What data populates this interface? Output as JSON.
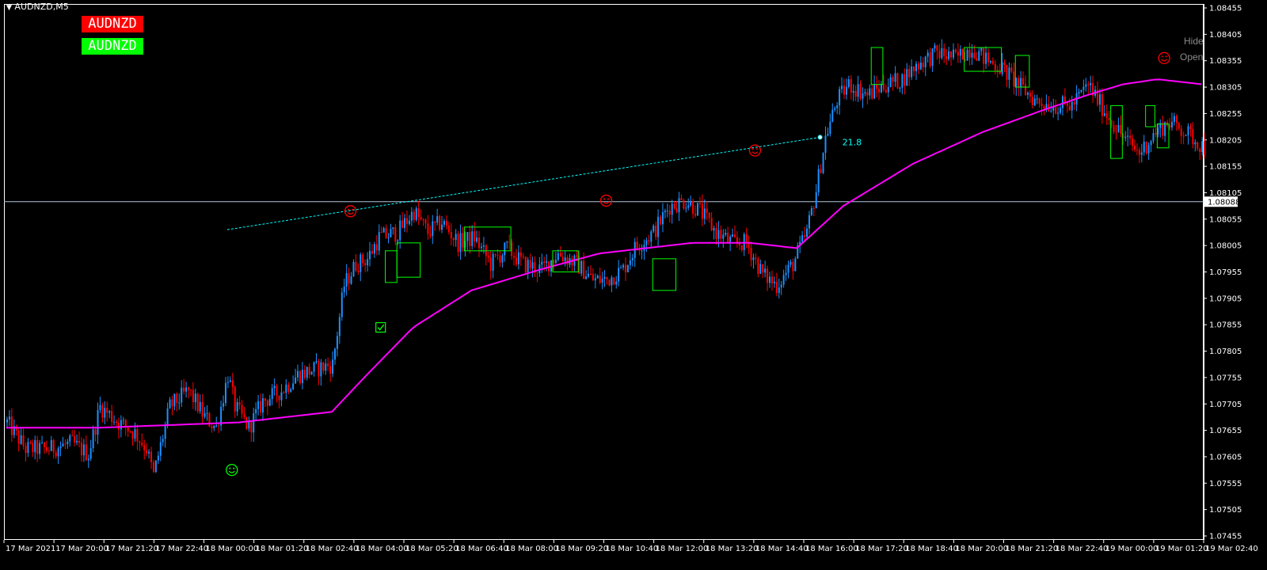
{
  "window": {
    "title": "AUDNZD,M5"
  },
  "badges": [
    {
      "label": "AUDNZD",
      "color": "#ff0000"
    },
    {
      "label": "AUDNZD",
      "color": "#00ff00"
    }
  ],
  "side_buttons": {
    "hide": "Hide",
    "open": "Open"
  },
  "colors": {
    "background": "#000000",
    "bull_candle": "#1e90ff",
    "bear_candle": "#ff0000",
    "moving_average": "#ff00ff",
    "trend_line": "#00ffff",
    "price_line": "#b0c4de",
    "axis": "#ffffff",
    "box": "#00ff00",
    "smiley_red": "#ff0000",
    "smiley_green": "#00ff00"
  },
  "chart_data": {
    "type": "candlestick",
    "symbol": "AUDNZD",
    "timeframe": "M5",
    "ylim": [
      1.07455,
      1.08455
    ],
    "y_ticks": [
      "1.08455",
      "1.08405",
      "1.08355",
      "1.08305",
      "1.08255",
      "1.08205",
      "1.08155",
      "1.08105",
      "1.08055",
      "1.08005",
      "1.07955",
      "1.07905",
      "1.07855",
      "1.07805",
      "1.07755",
      "1.07705",
      "1.07655",
      "1.07605",
      "1.07555",
      "1.07505",
      "1.07455"
    ],
    "x_ticks": [
      "17 Mar 2021",
      "17 Mar 20:00",
      "17 Mar 21:20",
      "17 Mar 22:40",
      "18 Mar 00:00",
      "18 Mar 01:20",
      "18 Mar 02:40",
      "18 Mar 04:00",
      "18 Mar 05:20",
      "18 Mar 06:40",
      "18 Mar 08:00",
      "18 Mar 09:20",
      "18 Mar 10:40",
      "18 Mar 12:00",
      "18 Mar 13:20",
      "18 Mar 14:40",
      "18 Mar 16:00",
      "18 Mar 17:20",
      "18 Mar 18:40",
      "18 Mar 20:00",
      "18 Mar 21:20",
      "18 Mar 22:40",
      "19 Mar 00:00",
      "19 Mar 01:20",
      "19 Mar 02:40"
    ],
    "current_price": "1.08088",
    "trend_line": {
      "from": {
        "bar": 95,
        "price": 1.08035
      },
      "to": {
        "bar": 350,
        "price": 1.0821
      },
      "label": "21.8"
    },
    "price_path": [
      [
        0,
        1.0767
      ],
      [
        8,
        1.0762
      ],
      [
        18,
        1.0762
      ],
      [
        28,
        1.0763
      ],
      [
        35,
        1.0761
      ],
      [
        40,
        1.077
      ],
      [
        48,
        1.0767
      ],
      [
        55,
        1.0765
      ],
      [
        60,
        1.0762
      ],
      [
        63,
        1.0757
      ],
      [
        70,
        1.077
      ],
      [
        78,
        1.0773
      ],
      [
        85,
        1.0768
      ],
      [
        90,
        1.0766
      ],
      [
        95,
        1.0776
      ],
      [
        98,
        1.077
      ],
      [
        104,
        1.0766
      ],
      [
        110,
        1.0771
      ],
      [
        118,
        1.0773
      ],
      [
        125,
        1.0776
      ],
      [
        132,
        1.0777
      ],
      [
        140,
        1.0778
      ],
      [
        145,
        1.0793
      ],
      [
        150,
        1.0797
      ],
      [
        155,
        1.0798
      ],
      [
        160,
        1.0802
      ],
      [
        168,
        1.0803
      ],
      [
        175,
        1.0807
      ],
      [
        181,
        1.0803
      ],
      [
        187,
        1.0805
      ],
      [
        194,
        1.0801
      ],
      [
        201,
        1.0802
      ],
      [
        208,
        1.0797
      ],
      [
        215,
        1.08
      ],
      [
        222,
        1.0797
      ],
      [
        230,
        1.0796
      ],
      [
        237,
        1.0799
      ],
      [
        245,
        1.0797
      ],
      [
        252,
        1.0794
      ],
      [
        258,
        1.0794
      ],
      [
        265,
        1.0796
      ],
      [
        270,
        1.08
      ],
      [
        278,
        1.0803
      ],
      [
        285,
        1.0808
      ],
      [
        292,
        1.0809
      ],
      [
        298,
        1.0807
      ],
      [
        305,
        1.0803
      ],
      [
        312,
        1.0801
      ],
      [
        318,
        1.0801
      ],
      [
        325,
        1.0795
      ],
      [
        331,
        1.0793
      ],
      [
        338,
        1.0797
      ],
      [
        344,
        1.0803
      ],
      [
        348,
        1.0811
      ],
      [
        352,
        1.0821
      ],
      [
        357,
        1.0828
      ],
      [
        362,
        1.0831
      ],
      [
        370,
        1.0829
      ],
      [
        378,
        1.0831
      ],
      [
        385,
        1.0832
      ],
      [
        392,
        1.0835
      ],
      [
        400,
        1.0837
      ],
      [
        408,
        1.0836
      ],
      [
        415,
        1.0838
      ],
      [
        420,
        1.0836
      ],
      [
        428,
        1.0834
      ],
      [
        435,
        1.0831
      ],
      [
        442,
        1.0828
      ],
      [
        450,
        1.0827
      ],
      [
        458,
        1.0827
      ],
      [
        465,
        1.0831
      ],
      [
        472,
        1.0826
      ],
      [
        480,
        1.0821
      ],
      [
        487,
        1.0818
      ],
      [
        494,
        1.0822
      ],
      [
        500,
        1.0824
      ],
      [
        507,
        1.0822
      ],
      [
        515,
        1.0819
      ]
    ],
    "moving_average": [
      [
        0,
        1.0766
      ],
      [
        40,
        1.0766
      ],
      [
        100,
        1.0767
      ],
      [
        140,
        1.0769
      ],
      [
        155,
        1.0776
      ],
      [
        175,
        1.0785
      ],
      [
        200,
        1.0792
      ],
      [
        230,
        1.0796
      ],
      [
        255,
        1.0799
      ],
      [
        275,
        1.08
      ],
      [
        295,
        1.0801
      ],
      [
        320,
        1.0801
      ],
      [
        340,
        1.08
      ],
      [
        360,
        1.0808
      ],
      [
        390,
        1.0816
      ],
      [
        420,
        1.0822
      ],
      [
        445,
        1.0826
      ],
      [
        465,
        1.0829
      ],
      [
        480,
        1.0831
      ],
      [
        495,
        1.0832
      ],
      [
        515,
        1.0831
      ]
    ],
    "ma_dips": [
      [
        36,
        1.0769
      ],
      [
        100,
        1.0766
      ]
    ],
    "boxes": [
      {
        "b0": 163,
        "b1": 168,
        "hi": 1.07995,
        "lo": 1.07935
      },
      {
        "b0": 168,
        "b1": 178,
        "hi": 1.0801,
        "lo": 1.07945
      },
      {
        "b0": 197,
        "b1": 217,
        "hi": 1.0804,
        "lo": 1.07995
      },
      {
        "b0": 235,
        "b1": 246,
        "hi": 1.07995,
        "lo": 1.07955
      },
      {
        "b0": 278,
        "b1": 288,
        "hi": 1.0798,
        "lo": 1.0792
      },
      {
        "b0": 372,
        "b1": 377,
        "hi": 1.0838,
        "lo": 1.0831
      },
      {
        "b0": 412,
        "b1": 428,
        "hi": 1.0838,
        "lo": 1.08335
      },
      {
        "b0": 434,
        "b1": 440,
        "hi": 1.08365,
        "lo": 1.08305
      },
      {
        "b0": 475,
        "b1": 480,
        "hi": 1.0827,
        "lo": 1.0817
      },
      {
        "b0": 490,
        "b1": 494,
        "hi": 1.0827,
        "lo": 1.0823
      },
      {
        "b0": 495,
        "b1": 500,
        "hi": 1.08235,
        "lo": 1.0819
      }
    ],
    "markers": [
      {
        "type": "smiley-red",
        "bar": 148,
        "price": 1.0807
      },
      {
        "type": "smiley-green",
        "bar": 97,
        "price": 1.0758
      },
      {
        "type": "smiley-red",
        "bar": 258,
        "price": 1.0809
      },
      {
        "type": "smiley-red",
        "bar": 322,
        "price": 1.08185
      },
      {
        "type": "smiley-red",
        "bar": 498,
        "price": 1.0836
      },
      {
        "type": "check-green",
        "bar": 161,
        "price": 1.0785
      }
    ]
  }
}
